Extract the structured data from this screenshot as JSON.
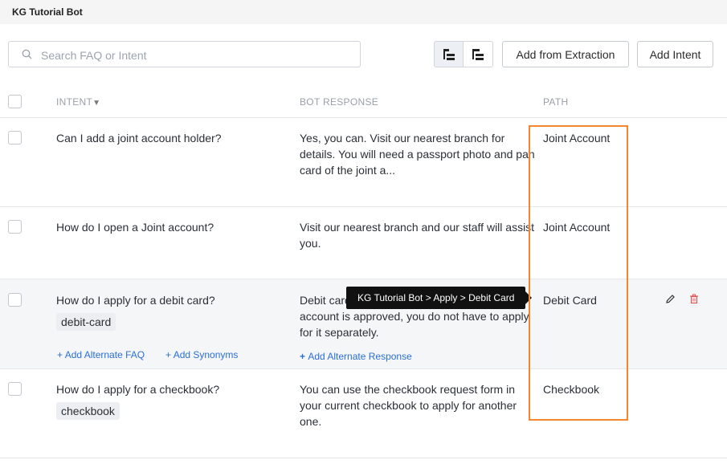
{
  "app": {
    "title": "KG Tutorial Bot"
  },
  "toolbar": {
    "search_placeholder": "Search FAQ or Intent",
    "add_extraction_label": "Add from Extraction",
    "add_intent_label": "Add Intent"
  },
  "table": {
    "headers": {
      "intent": "INTENT",
      "response": "BOT RESPONSE",
      "path": "PATH"
    },
    "rows": [
      {
        "intent": "Can I add a joint account holder?",
        "response": "Yes, you can. Visit our nearest branch for details. You will need a passport photo and pan card of the joint a...",
        "path": "Joint Account"
      },
      {
        "intent": "How do I open a Joint account?",
        "response": "Visit our nearest branch and our staff will assist you.",
        "path": "Joint Account"
      },
      {
        "intent": "How do I apply for a debit card?",
        "tag": "debit-card",
        "response": "Debit card is issued automatically once your account is approved, you do not have to apply for it separately.",
        "path": "Debit Card",
        "add_alt_faq": "Add Alternate FAQ",
        "add_synonyms": "Add Synonyms",
        "add_alt_response": "Add Alternate Response"
      },
      {
        "intent": "How do I apply for a checkbook?",
        "tag": "checkbook",
        "response": "You can use the checkbook request form in your current checkbook to apply for another one.",
        "path": "Checkbook"
      }
    ]
  },
  "tooltip": {
    "text": "KG Tutorial Bot > Apply > Debit Card"
  },
  "colors": {
    "link": "#2a6fd6",
    "highlight": "#f5862f",
    "delete": "#e05050"
  }
}
